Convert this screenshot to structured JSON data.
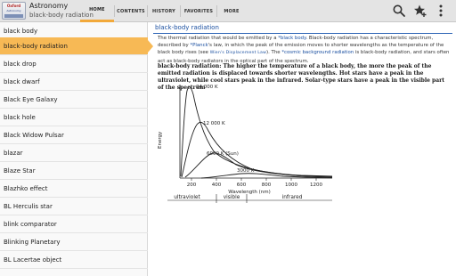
{
  "app": {
    "icon_lines": [
      "Oxford",
      "Astronomy"
    ],
    "title": "Astronomy",
    "subtitle": "black-body radiation"
  },
  "tabs": [
    {
      "label": "HOME",
      "active": true
    },
    {
      "label": "CONTENTS",
      "active": false
    },
    {
      "label": "HISTORY",
      "active": false
    },
    {
      "label": "FAVORITES",
      "active": false
    },
    {
      "label": "MORE",
      "active": false
    }
  ],
  "actions": {
    "search_icon": "search-icon",
    "favorite_icon": "star-add-icon",
    "overflow_icon": "overflow-menu-icon"
  },
  "list": {
    "items": [
      "black body",
      "black-body radiation",
      "black drop",
      "black dwarf",
      "Black Eye Galaxy",
      "black hole",
      "Black Widow Pulsar",
      "blazar",
      "Blaze Star",
      "Blazhko effect",
      "BL Herculis star",
      "blink comparator",
      "Blinking Planetary",
      "BL Lacertae object"
    ],
    "selected_index": 1
  },
  "article": {
    "title": "black-body radiation",
    "body": {
      "p1": "The thermal radiation that would be emitted by a ",
      "link1": "*black body",
      "p2": ". Black-body radiation has a characteristic spectrum, described by ",
      "link2": "*Planck",
      "p3": "'s law, in which the peak of the emission moves to shorter wavelengths as the temperature of the black body rises (see ",
      "link3": "Wien's Displacement Law",
      "p4": "). The ",
      "link4": "*cosmic background radiation",
      "p5": " is black-body radiation, and stars often act as black-body radiators in the optical part of the spectrum."
    },
    "caption": "black-body radiation: The higher the temperature of a black body, the more the peak of the emitted radiation is displaced towards shorter wavelengths. Hot stars have a peak in the ultraviolet, while cool stars peak in the infrared. Solar-type stars have a peak in the visible part of the spectrum"
  },
  "figure": {
    "ylabel": "Energy",
    "xlabel": "Wavelength (nm)",
    "xticks": [
      "200",
      "400",
      "600",
      "800",
      "1000",
      "1200"
    ],
    "curves": [
      {
        "label": "24 000 K"
      },
      {
        "label": "12 000 K"
      },
      {
        "label": "6000 K (Sun)"
      },
      {
        "label": "3000 K"
      }
    ],
    "bands": [
      "ultraviolet",
      "visible",
      "infrared"
    ]
  },
  "colors": {
    "accent": "#f7b955",
    "tab_underline": "#f2a93b",
    "link": "#1a4fa0",
    "bar_bg": "#e4e4e4"
  }
}
